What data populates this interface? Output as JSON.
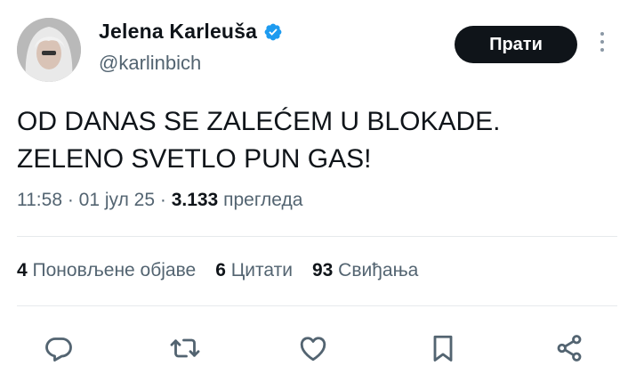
{
  "author": {
    "display_name": "Jelena Karleuša",
    "handle": "@karlinbich"
  },
  "follow_label": "Прати",
  "tweet_lines": [
    "OD DANAS SE ZALEĆEM U BLOKADE.",
    "ZELENO SVETLO PUN GAS!"
  ],
  "meta": {
    "time": "11:58",
    "sep1": " · ",
    "date": "01 јул 25",
    "sep2": " · ",
    "views_count": "3.133",
    "views_label": " прегледа"
  },
  "stats": [
    {
      "count": "4",
      "label": "Поновљене објаве"
    },
    {
      "count": "6",
      "label": "Цитати"
    },
    {
      "count": "93",
      "label": "Свиђања"
    }
  ],
  "icons": {
    "verified": "verified-badge-icon",
    "reply": "reply-icon",
    "repost": "repost-icon",
    "like": "heart-icon",
    "bookmark": "bookmark-icon",
    "share": "share-icon"
  },
  "colors": {
    "verified": "#1d9bf0",
    "muted": "#536471",
    "text": "#0f1419",
    "button": "#0f1419"
  }
}
